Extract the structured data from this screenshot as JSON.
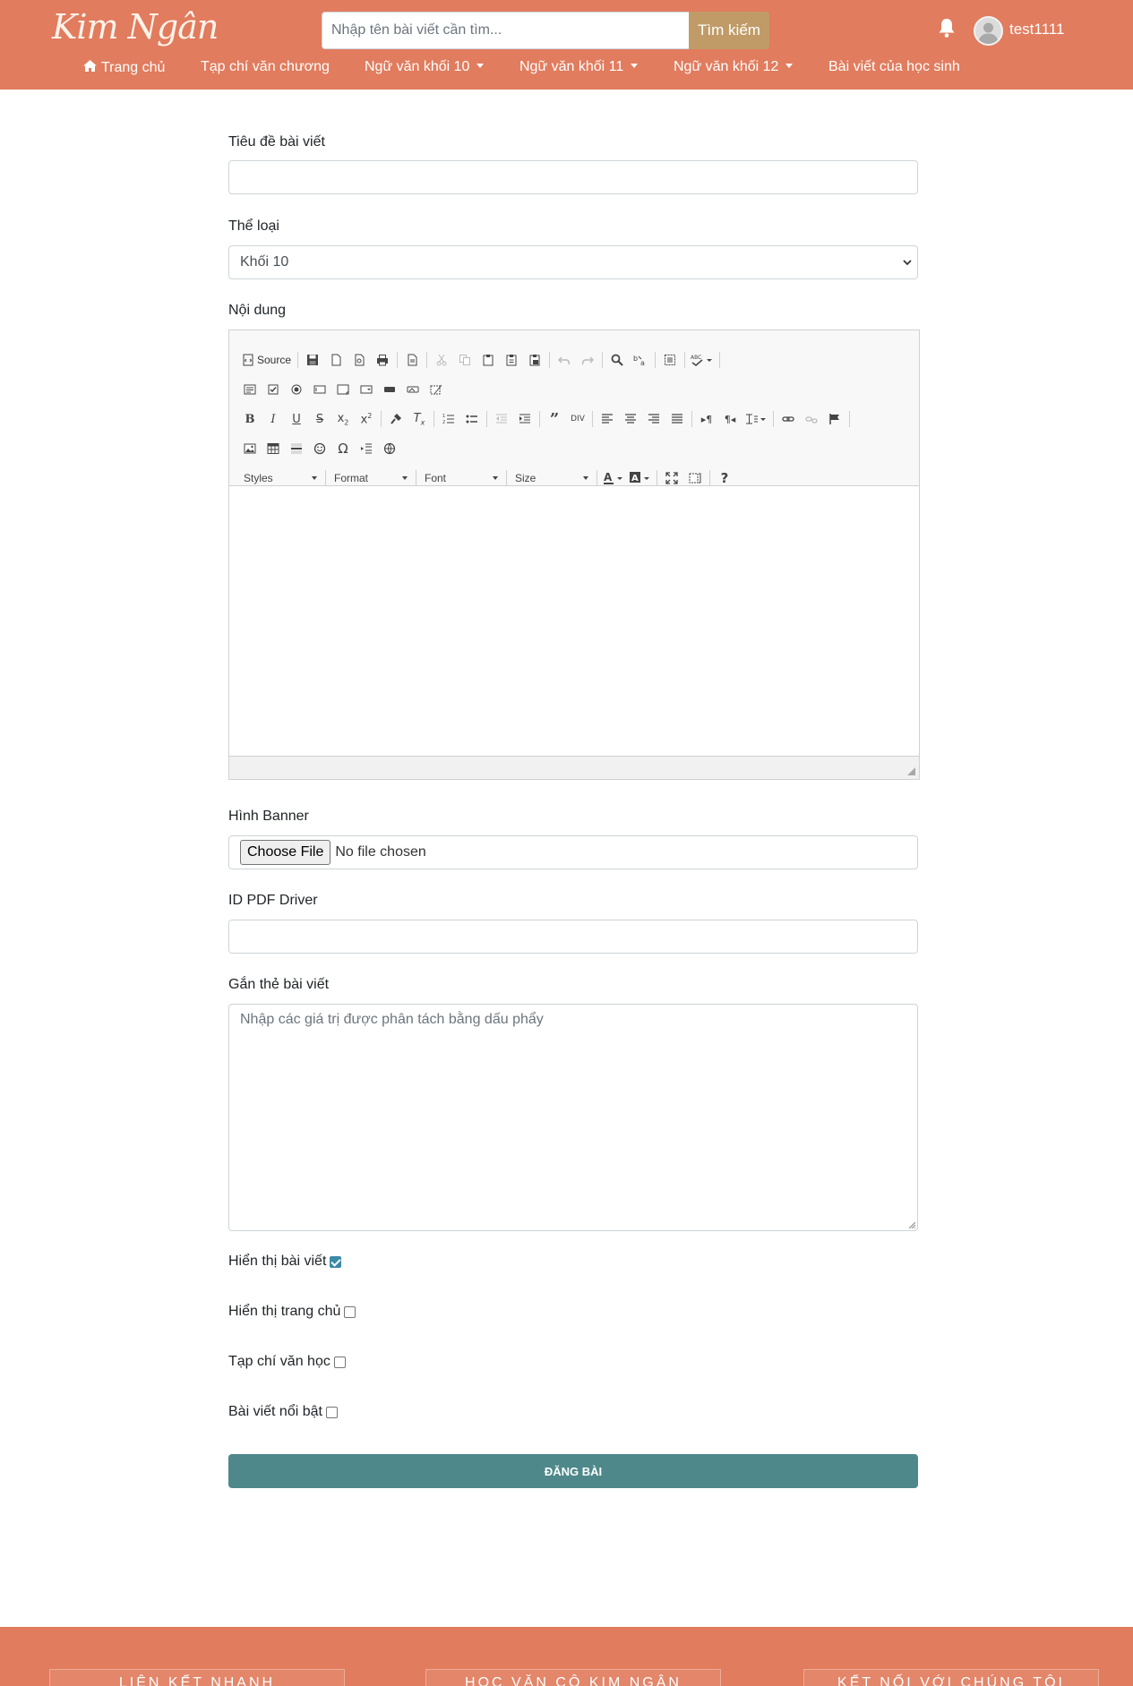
{
  "header": {
    "logo": "Kim Ngân",
    "search_placeholder": "Nhập tên bài viết cần tìm...",
    "search_button": "Tìm kiếm",
    "username": "test1111"
  },
  "nav": {
    "items": [
      {
        "label": "Trang chủ",
        "dropdown": false
      },
      {
        "label": "Tạp chí văn chương",
        "dropdown": false
      },
      {
        "label": "Ngữ văn khối 10",
        "dropdown": true
      },
      {
        "label": "Ngữ văn khối 11",
        "dropdown": true
      },
      {
        "label": "Ngữ văn khối 12",
        "dropdown": true
      },
      {
        "label": "Bài viết của học sinh",
        "dropdown": false
      }
    ]
  },
  "form": {
    "title_label": "Tiêu đề bài viết",
    "title_value": "",
    "category_label": "Thể loại",
    "category_value": "Khối 10",
    "content_label": "Nội dung",
    "banner_label": "Hình Banner",
    "file_button": "Choose File",
    "file_status": "No file chosen",
    "pdf_label": "ID PDF Driver",
    "pdf_value": "",
    "tags_label": "Gắn thẻ bài viết",
    "tags_placeholder": "Nhập các giá trị được phân tách bằng dấu phẩy",
    "checks": [
      {
        "label": "Hiển thị bài viết",
        "checked": true
      },
      {
        "label": "Hiển thị trang chủ",
        "checked": false
      },
      {
        "label": "Tạp chí văn học",
        "checked": false
      },
      {
        "label": "Bài viết nổi bật",
        "checked": false
      }
    ],
    "submit": "ĐĂNG BÀI"
  },
  "editor": {
    "source_label": "Source",
    "combos": [
      "Styles",
      "Format",
      "Font",
      "Size"
    ]
  },
  "footer": {
    "sections": [
      "LIÊN KẾT NHANH",
      "HỌC VĂN CÔ KIM NGÂN",
      "KẾT NỐI VỚI CHÚNG TÔI"
    ]
  },
  "colors": {
    "header_bg": "#e17c5e",
    "search_button": "#c09b68",
    "submit_button": "#4e888a"
  }
}
